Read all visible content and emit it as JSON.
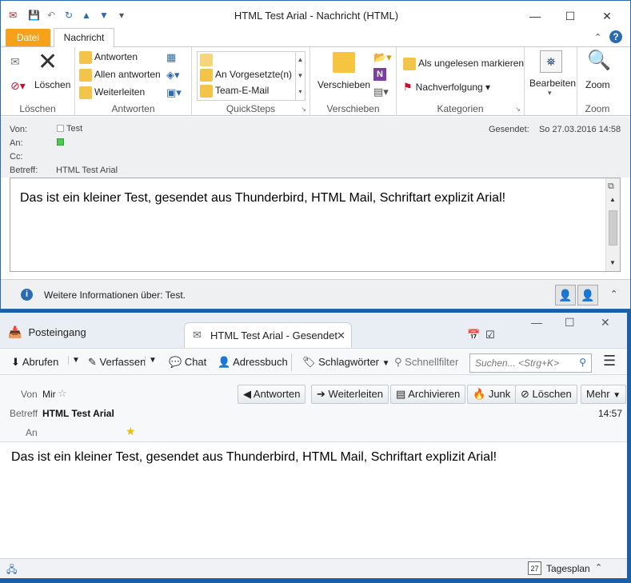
{
  "outlook": {
    "title": "HTML Test Arial  -  Nachricht (HTML)",
    "tabs": {
      "file": "Datei",
      "message": "Nachricht"
    },
    "ribbon": {
      "loeschen": {
        "delete": "Löschen",
        "group": "Löschen"
      },
      "antworten": {
        "reply": "Antworten",
        "reply_all": "Allen antworten",
        "forward": "Weiterleiten",
        "group": "Antworten"
      },
      "quicksteps": {
        "item1": "An Vorgesetzte(n)",
        "item2": "Team-E-Mail",
        "group": "QuickSteps"
      },
      "verschieben": {
        "move": "Verschieben",
        "group": "Verschieben"
      },
      "kategorien": {
        "unread": "Als ungelesen markieren",
        "followup": "Nachverfolgung",
        "group": "Kategorien"
      },
      "bearbeiten": {
        "label": "Bearbeiten"
      },
      "zoom": {
        "label": "Zoom",
        "group": "Zoom"
      }
    },
    "header": {
      "from_label": "Von:",
      "from_value": "Test",
      "to_label": "An:",
      "cc_label": "Cc:",
      "subject_label": "Betreff:",
      "subject_value": "HTML Test Arial",
      "sent_label": "Gesendet:",
      "sent_value": "So 27.03.2016 14:58"
    },
    "body": "Das ist ein kleiner Test, gesendet aus Thunderbird, HTML Mail, Schriftart explizit Arial!",
    "infobar": "Weitere Informationen über: Test."
  },
  "thunderbird": {
    "tabs": {
      "inbox": "Posteingang",
      "message": "HTML Test Arial - Gesendet"
    },
    "toolbar": {
      "get": "Abrufen",
      "write": "Verfassen",
      "chat": "Chat",
      "addressbook": "Adressbuch",
      "tag": "Schlagwörter",
      "quickfilter": "Schnellfilter",
      "search_placeholder": "Suchen... <Strg+K>"
    },
    "header": {
      "from_label": "Von",
      "from_value": "Mir",
      "subject_label": "Betreff",
      "subject_value": "HTML Test Arial",
      "to_label": "An",
      "time": "14:57",
      "buttons": {
        "reply": "Antworten",
        "forward": "Weiterleiten",
        "archive": "Archivieren",
        "junk": "Junk",
        "delete": "Löschen",
        "more": "Mehr"
      }
    },
    "body": "Das ist ein kleiner Test, gesendet aus Thunderbird, HTML Mail, Schriftart explizit Arial!",
    "status": {
      "today": "Tagesplan",
      "calendar_day": "27"
    }
  },
  "colors": {
    "file_tab": "#f7a11a",
    "desktop": "#1c5fa8",
    "accent_blue": "#2b6cb0"
  }
}
